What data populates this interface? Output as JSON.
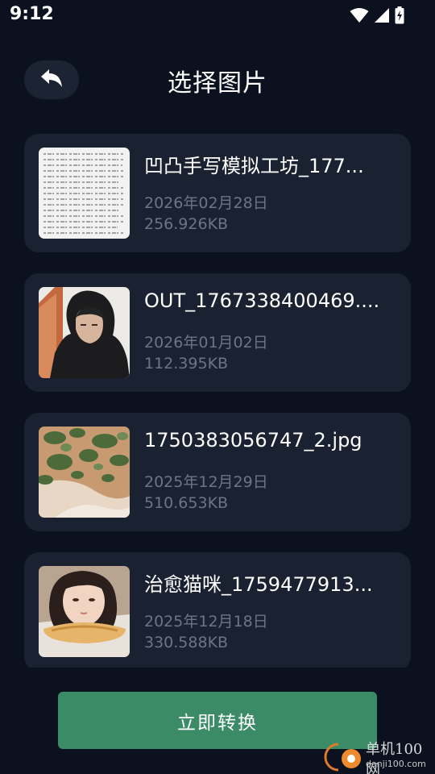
{
  "status_bar": {
    "time": "9:12",
    "icons": [
      "wifi-icon",
      "signal-icon",
      "battery-charging-icon"
    ]
  },
  "header": {
    "back_icon": "back-arrow-icon",
    "title": "选择图片"
  },
  "images": [
    {
      "name": "凹凸手写模拟工坊_177...",
      "date": "2026年02月28日",
      "size": "256.926KB",
      "thumb": "handwritten-document-thumbnail"
    },
    {
      "name": "OUT_1767338400469....",
      "date": "2026年01月02日",
      "size": "112.395KB",
      "thumb": "person-hoodie-thumbnail"
    },
    {
      "name": "1750383056747_2.jpg",
      "date": "2025年12月29日",
      "size": "510.653KB",
      "thumb": "aerial-landscape-thumbnail"
    },
    {
      "name": "治愈猫咪_1759477913...",
      "date": "2025年12月18日",
      "size": "330.588KB",
      "thumb": "girl-pillow-thumbnail"
    }
  ],
  "actions": {
    "convert_label": "立即转换"
  },
  "watermark": {
    "cn": "单机100网",
    "en": "danji100.com"
  },
  "colors": {
    "background": "#0b111e",
    "card": "#1a2130",
    "accent_button": "#3a8b66",
    "secondary_text": "#6c7585"
  }
}
